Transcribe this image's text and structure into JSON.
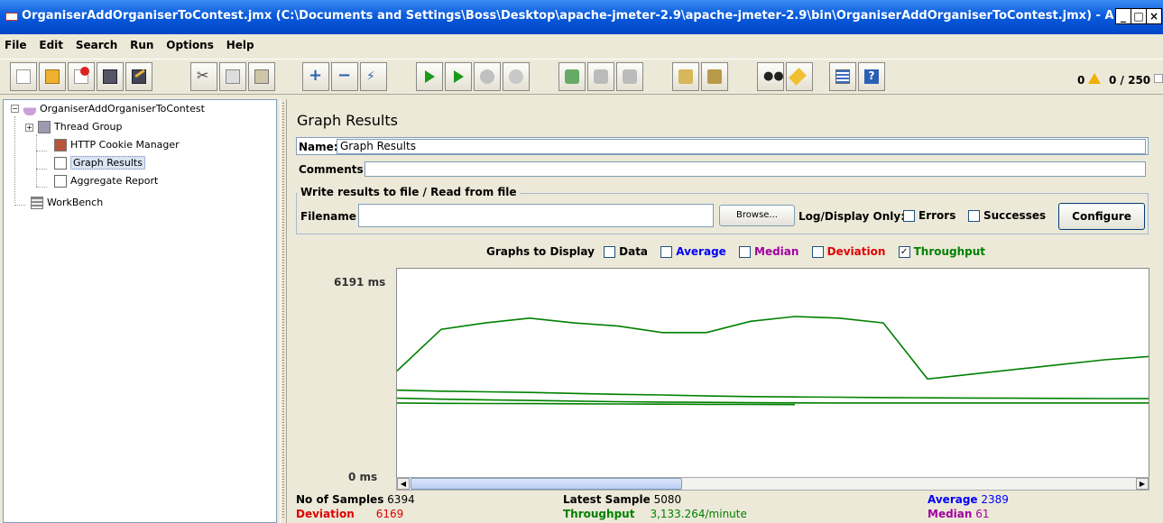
{
  "window": {
    "title": "OrganiserAddOrganiserToContest.jmx (C:\\Documents and Settings\\Boss\\Desktop\\apache-jmeter-2.9\\apache-jmeter-2.9\\bin\\OrganiserAddOrganiserToContest.jmx) - Apache ..."
  },
  "menu": [
    "File",
    "Edit",
    "Search",
    "Run",
    "Options",
    "Help"
  ],
  "toolbar": {
    "error_count": "0",
    "threads": "0 / 250"
  },
  "tree": {
    "root": "OrganiserAddOrganiserToContest",
    "thread_group": "Thread Group",
    "cookie_manager": "HTTP Cookie Manager",
    "graph_results": "Graph Results",
    "aggregate_report": "Aggregate Report",
    "workbench": "WorkBench"
  },
  "panel": {
    "title": "Graph Results",
    "name_label": "Name:",
    "name_value": "Graph Results",
    "comments_label": "Comments:",
    "comments_value": "",
    "file_legend": "Write results to file / Read from file",
    "filename_label": "Filename",
    "filename_value": "",
    "browse_label": "Browse...",
    "log_display_label": "Log/Display Only:",
    "errors_label": "Errors",
    "successes_label": "Successes",
    "configure_label": "Configure"
  },
  "graphs": {
    "label": "Graphs to Display",
    "options": [
      {
        "label": "Data",
        "checked": false,
        "color": "#000000"
      },
      {
        "label": "Average",
        "checked": false,
        "color": "#0000ff"
      },
      {
        "label": "Median",
        "checked": false,
        "color": "#a000a0"
      },
      {
        "label": "Deviation",
        "checked": false,
        "color": "#e00000"
      },
      {
        "label": "Throughput",
        "checked": true,
        "color": "#008000"
      }
    ],
    "y_max": "6191 ms",
    "y_min": "0 ms"
  },
  "chart_data": {
    "type": "line",
    "ylim": [
      0,
      6191
    ],
    "series": [
      {
        "values": [
          3000,
          4300,
          4500,
          4650,
          4500,
          4400,
          4200,
          4200,
          4550,
          4700,
          4650,
          4500,
          2750,
          2900,
          3050,
          3200,
          3350,
          3450
        ]
      },
      {
        "values": [
          2400,
          2370,
          2350,
          2330,
          2300,
          2270,
          2250,
          2220,
          2200,
          2190,
          2180,
          2170,
          2160,
          2155,
          2150,
          2145,
          2140,
          2135
        ]
      },
      {
        "values": [
          2150,
          2120,
          2100,
          2080,
          2060,
          2040,
          2030,
          2020,
          2010,
          2005,
          2000,
          2000,
          2000,
          2000,
          2000,
          2000,
          2000,
          2000
        ]
      },
      {
        "values": [
          2000,
          1990,
          1985,
          1980,
          1975,
          1970,
          1965,
          1960,
          1955,
          1950
        ]
      }
    ]
  },
  "stats": {
    "samples_label": "No of Samples",
    "samples_value": "6394",
    "deviation_label": "Deviation",
    "deviation_value": "6169",
    "latest_label": "Latest Sample",
    "latest_value": "5080",
    "throughput_label": "Throughput",
    "throughput_value": "3,133.264/minute",
    "average_label": "Average",
    "average_value": "2389",
    "median_label": "Median",
    "median_value": "61"
  }
}
